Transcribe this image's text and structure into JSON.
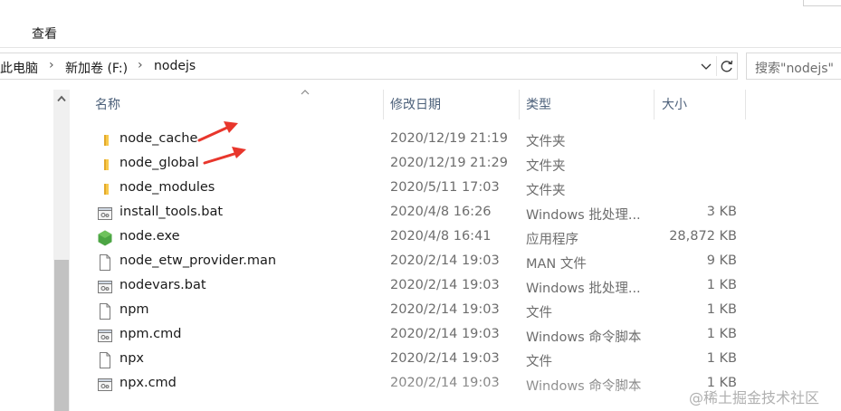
{
  "ribbon": {
    "tab_view": "查看"
  },
  "address": {
    "segments": [
      "此电脑",
      "新加卷 (F:)",
      "nodejs"
    ]
  },
  "search": {
    "placeholder": "搜索\"nodejs\""
  },
  "columns": {
    "name": "名称",
    "modified": "修改日期",
    "type": "类型",
    "size": "大小"
  },
  "files": [
    {
      "name": "node_cache",
      "modified": "2020/12/19 21:19",
      "type": "文件夹",
      "size": "",
      "icon": "folder-icon"
    },
    {
      "name": "node_global",
      "modified": "2020/12/19 21:29",
      "type": "文件夹",
      "size": "",
      "icon": "folder-icon"
    },
    {
      "name": "node_modules",
      "modified": "2020/5/11 17:03",
      "type": "文件夹",
      "size": "",
      "icon": "folder-icon"
    },
    {
      "name": "install_tools.bat",
      "modified": "2020/4/8 16:26",
      "type": "Windows 批处理...",
      "size": "3 KB",
      "icon": "batch-file-icon"
    },
    {
      "name": "node.exe",
      "modified": "2020/4/8 16:41",
      "type": "应用程序",
      "size": "28,872 KB",
      "icon": "node-exe-icon"
    },
    {
      "name": "node_etw_provider.man",
      "modified": "2020/2/14 19:03",
      "type": "MAN 文件",
      "size": "9 KB",
      "icon": "file-icon"
    },
    {
      "name": "nodevars.bat",
      "modified": "2020/2/14 19:03",
      "type": "Windows 批处理...",
      "size": "1 KB",
      "icon": "batch-file-icon"
    },
    {
      "name": "npm",
      "modified": "2020/2/14 19:03",
      "type": "文件",
      "size": "1 KB",
      "icon": "file-icon"
    },
    {
      "name": "npm.cmd",
      "modified": "2020/2/14 19:03",
      "type": "Windows 命令脚本",
      "size": "1 KB",
      "icon": "batch-file-icon"
    },
    {
      "name": "npx",
      "modified": "2020/2/14 19:03",
      "type": "文件",
      "size": "1 KB",
      "icon": "file-icon"
    },
    {
      "name": "npx.cmd",
      "modified": "2020/2/14 19:03",
      "type": "Windows 命令脚本",
      "size": "1 KB",
      "icon": "batch-file-icon"
    }
  ],
  "watermark": "@稀土掘金技术社区",
  "colors": {
    "folder": "#f8c94b",
    "annotation_arrow": "#e8362c",
    "node_green": "#4ca544",
    "header_text": "#4c607a"
  }
}
